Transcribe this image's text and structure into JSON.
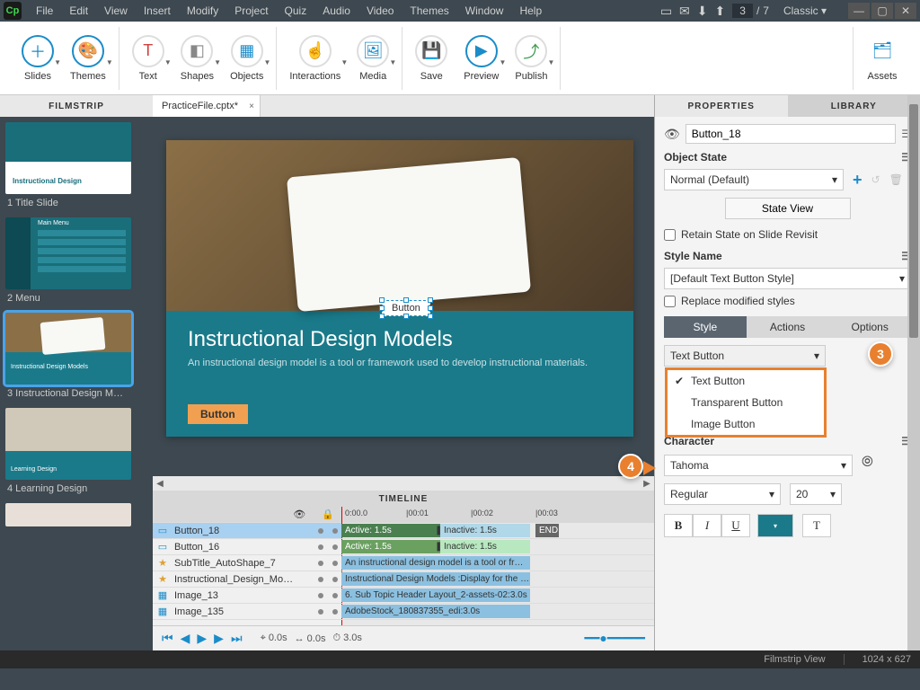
{
  "app": {
    "logo": "Cp"
  },
  "menus": [
    "File",
    "Edit",
    "View",
    "Insert",
    "Modify",
    "Project",
    "Quiz",
    "Audio",
    "Video",
    "Themes",
    "Window",
    "Help"
  ],
  "titlebar": {
    "current_slide": "3",
    "total_slides": "7",
    "layout": "Classic"
  },
  "toolbar": {
    "slides": "Slides",
    "themes": "Themes",
    "text": "Text",
    "shapes": "Shapes",
    "objects": "Objects",
    "interactions": "Interactions",
    "media": "Media",
    "save": "Save",
    "preview": "Preview",
    "publish": "Publish",
    "assets": "Assets"
  },
  "filmstrip": {
    "header": "FILMSTRIP",
    "items": [
      {
        "label": "1 Title Slide",
        "title_text": "Instructional Design"
      },
      {
        "label": "2 Menu",
        "menu_title": "Main Menu"
      },
      {
        "label": "3 Instructional Design M…",
        "title_text": "Instructional Design Models"
      },
      {
        "label": "4 Learning Design",
        "title_text": "Learning Design"
      }
    ]
  },
  "file_tab": "PracticeFile.cptx*",
  "slide": {
    "title": "Instructional Design Models",
    "subtitle": "An instructional design model is a tool or framework used to develop instructional materials.",
    "button_caption": "Button",
    "selected_obj": "Button"
  },
  "timeline": {
    "header": "TIMELINE",
    "end": "END",
    "ticks": [
      "0:00.0",
      "|00:01",
      "|00:02",
      "|00:03"
    ],
    "rows": [
      {
        "icon": "▭",
        "name": "Button_18",
        "bar1": "Active: 1.5s",
        "bar2": "Inactive: 1.5s",
        "selected": true
      },
      {
        "icon": "▭",
        "name": "Button_16",
        "bar1": "Active: 1.5s",
        "bar2": "Inactive: 1.5s"
      },
      {
        "icon": "★",
        "name": "SubTitle_AutoShape_7",
        "text": "An instructional design model is a tool or fr…"
      },
      {
        "icon": "★",
        "name": "Instructional_Design_Mo…",
        "text": "Instructional Design Models :Display for the …"
      },
      {
        "icon": "▦",
        "name": "Image_13",
        "text": "6. Sub Topic Header Layout_2-assets-02:3.0s"
      },
      {
        "icon": "▦",
        "name": "Image_135",
        "text": "AdobeStock_180837355_edi:3.0s"
      }
    ],
    "controls": {
      "time_a": "0.0s",
      "time_b": "0.0s",
      "time_c": "3.0s"
    }
  },
  "properties": {
    "tab_properties": "PROPERTIES",
    "tab_library": "LIBRARY",
    "object_name": "Button_18",
    "section_state": "Object State",
    "state_value": "Normal (Default)",
    "state_view": "State View",
    "retain_state": "Retain State on Slide Revisit",
    "section_style": "Style Name",
    "style_value": "[Default Text Button Style]",
    "replace_styles": "Replace modified styles",
    "sub_tabs": {
      "style": "Style",
      "actions": "Actions",
      "options": "Options"
    },
    "button_type": "Text Button",
    "dropdown_options": [
      "Text Button",
      "Transparent Button",
      "Image Button"
    ],
    "section_character": "Character",
    "font_family": "Tahoma",
    "font_style": "Regular",
    "font_size": "20",
    "bold": "B",
    "italic": "I",
    "underline": "U",
    "highlight": "T"
  },
  "callouts": {
    "c3": "3",
    "c4": "4"
  },
  "statusbar": {
    "view": "Filmstrip View",
    "dims": "1024 x 627"
  }
}
